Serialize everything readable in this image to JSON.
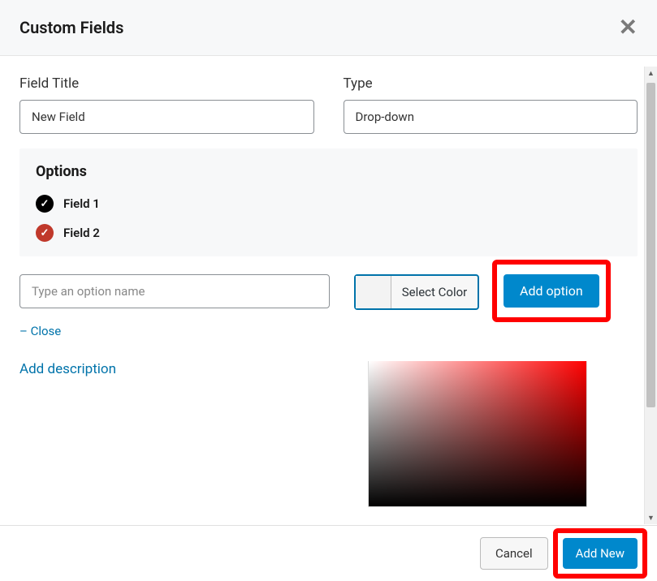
{
  "header": {
    "title": "Custom Fields"
  },
  "fields": {
    "title_label": "Field Title",
    "title_value": "New Field",
    "type_label": "Type",
    "type_value": "Drop-down"
  },
  "options": {
    "heading": "Options",
    "items": [
      {
        "label": "Field 1",
        "color": "#000000"
      },
      {
        "label": "Field 2",
        "color": "#c0392b"
      }
    ]
  },
  "add_option": {
    "placeholder": "Type an option name",
    "select_color_label": "Select Color",
    "button_label": "Add option",
    "close_label": "– Close"
  },
  "links": {
    "add_description": "Add description"
  },
  "footer": {
    "cancel": "Cancel",
    "add_new": "Add New"
  },
  "colors": {
    "primary": "#0088cc",
    "highlight": "#ff0000"
  }
}
